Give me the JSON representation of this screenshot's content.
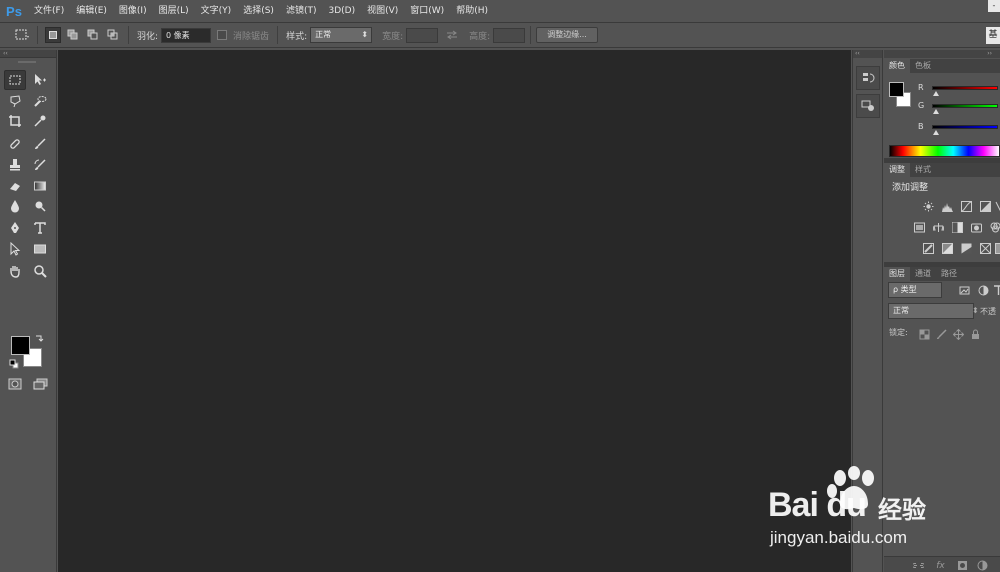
{
  "app": {
    "logo": "Ps"
  },
  "menu": [
    "文件(F)",
    "编辑(E)",
    "图像(I)",
    "图层(L)",
    "文字(Y)",
    "选择(S)",
    "滤镜(T)",
    "3D(D)",
    "视图(V)",
    "窗口(W)",
    "帮助(H)"
  ],
  "window": {
    "control": "-"
  },
  "options": {
    "feather_label": "羽化:",
    "feather_value": "0 像素",
    "antialias_label": "消除锯齿",
    "style_label": "样式:",
    "style_value": "正常",
    "width_label": "宽度:",
    "height_label": "高度:",
    "refine_button": "调整边缘...",
    "workspace": "基"
  },
  "color_panel": {
    "tabs": [
      "颜色",
      "色板"
    ],
    "channels": [
      {
        "label": "R",
        "color": "#ff0000"
      },
      {
        "label": "G",
        "color": "#00ff00"
      },
      {
        "label": "B",
        "color": "#0000ff"
      }
    ]
  },
  "adjust_panel": {
    "tabs": [
      "调整",
      "样式"
    ],
    "title": "添加调整"
  },
  "layers_panel": {
    "tabs": [
      "图层",
      "通道",
      "路径"
    ],
    "filter_value": "ρ 类型",
    "blend_value": "正常",
    "opacity_label": "不透",
    "lock_label": "锁定:"
  },
  "watermark": {
    "brand": "Bai du",
    "brand_cn": "经验",
    "url": "jingyan.baidu.com"
  },
  "colors": {
    "ps_blue": "#3d9bea",
    "canvas": "#282828",
    "chrome": "#535353"
  }
}
